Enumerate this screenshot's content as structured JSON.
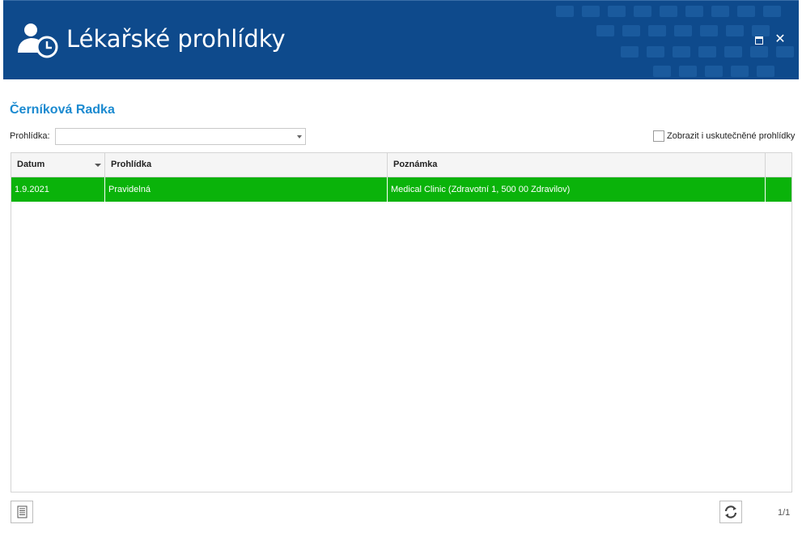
{
  "window": {
    "title": "Lékařské prohlídky",
    "icon": "person-clock-icon",
    "controls": [
      "maximize-icon",
      "close-icon"
    ],
    "colors": {
      "header": "#0e4a8c",
      "accent": "#1b8ad0",
      "row_selected": "#0ab30a"
    }
  },
  "person_name": "Černíková Radka",
  "filter": {
    "label": "Prohlídka:",
    "value": ""
  },
  "checkbox": {
    "label": "Zobrazit i uskutečněné prohlídky",
    "checked": false
  },
  "grid": {
    "columns": [
      "Datum",
      "Prohlídka",
      "Poznámka",
      ""
    ],
    "rows": [
      {
        "datum": "1.9.2021",
        "prohlidka": "Pravidelná",
        "poznamka": "Medical Clinic (Zdravotní 1, 500 00 Zdravilov)"
      }
    ]
  },
  "footer": {
    "page_indicator": "1/1",
    "left_button_icon": "document-icon",
    "right_button_icon": "refresh-icon"
  }
}
